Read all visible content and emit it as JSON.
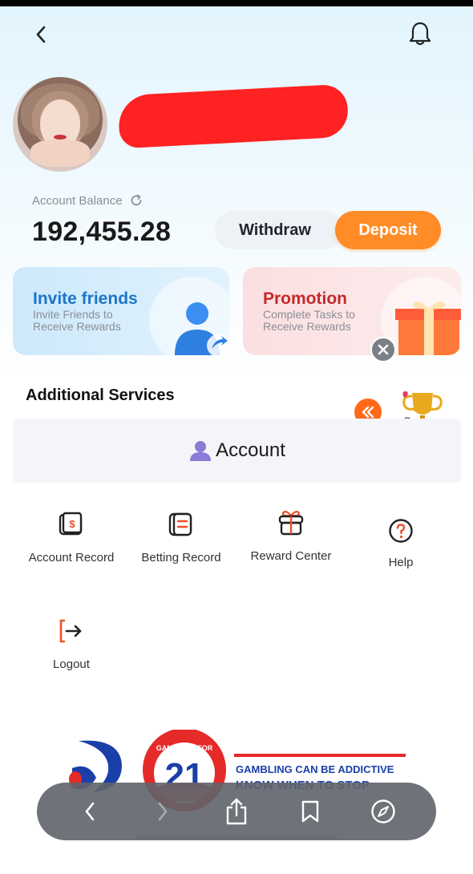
{
  "header": {
    "back_icon": "chevron-left-icon",
    "bell_icon": "bell-icon"
  },
  "account": {
    "balance_label": "Account Balance",
    "balance_value": "192,455.28",
    "withdraw_label": "Withdraw",
    "deposit_label": "Deposit"
  },
  "cards": {
    "invite": {
      "title": "Invite friends",
      "subtitle": "Invite Friends to Receive Rewards"
    },
    "promo": {
      "title": "Promotion",
      "subtitle": "Complete Tasks to Receive Rewards"
    }
  },
  "services": {
    "title": "Additional Services",
    "panel_label": "Account",
    "items": [
      {
        "label": "Account Record",
        "icon": "wallet-dollar-icon"
      },
      {
        "label": "Betting Record",
        "icon": "receipt-icon"
      },
      {
        "label": "Reward Center",
        "icon": "gift-icon"
      },
      {
        "label": "Help",
        "icon": "question-circle-icon"
      },
      {
        "label": "Logout",
        "icon": "logout-icon"
      }
    ]
  },
  "banner": {
    "badge_text": "21",
    "badge_top_text": "GAMBLING FOR",
    "line1": "GAMBLING CAN BE ADDICTIVE",
    "line2": "KNOW WHEN TO STOP"
  },
  "colors": {
    "accent_orange": "#ff8c26",
    "invite_blue": "#1d75c9",
    "promo_red": "#c42a2a"
  }
}
